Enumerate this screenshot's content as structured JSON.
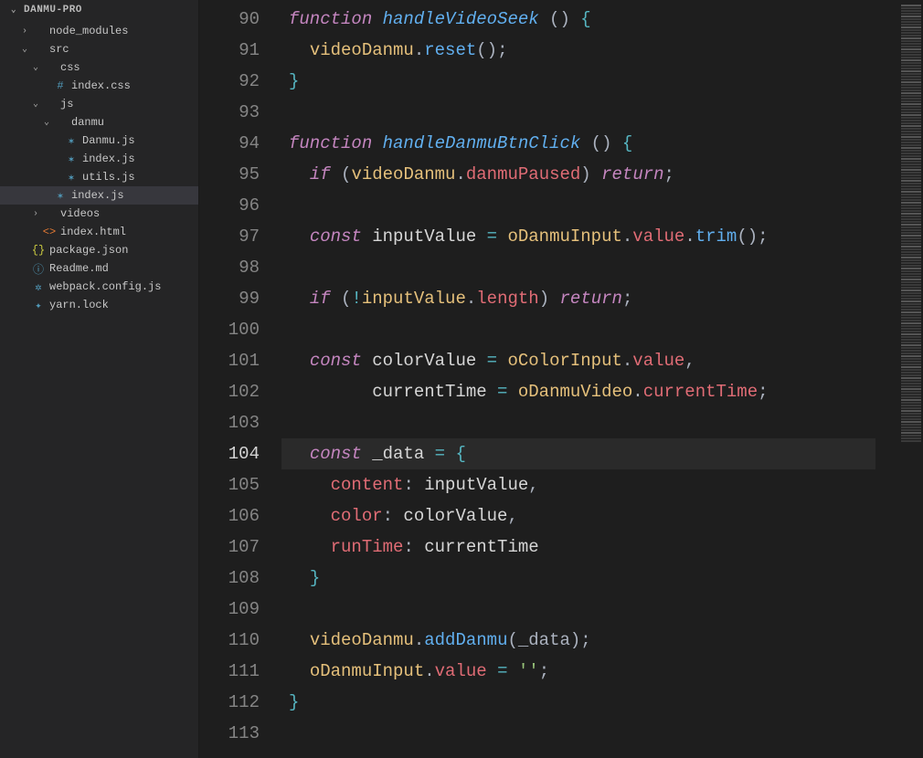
{
  "project": {
    "name": "DANMU-PRO"
  },
  "tree": [
    {
      "depth": 1,
      "twisty": "›",
      "iconClass": "",
      "iconGlyph": "",
      "label": "node_modules",
      "name": "folder-node-modules"
    },
    {
      "depth": 1,
      "twisty": "⌄",
      "iconClass": "",
      "iconGlyph": "",
      "label": "src",
      "name": "folder-src"
    },
    {
      "depth": 2,
      "twisty": "⌄",
      "iconClass": "",
      "iconGlyph": "",
      "label": "css",
      "name": "folder-css"
    },
    {
      "depth": 3,
      "twisty": "",
      "iconClass": "ic-css",
      "iconGlyph": "#",
      "label": "index.css",
      "name": "file-index-css"
    },
    {
      "depth": 2,
      "twisty": "⌄",
      "iconClass": "",
      "iconGlyph": "",
      "label": "js",
      "name": "folder-js"
    },
    {
      "depth": 3,
      "twisty": "⌄",
      "iconClass": "",
      "iconGlyph": "",
      "label": "danmu",
      "name": "folder-danmu"
    },
    {
      "depth": 4,
      "twisty": "",
      "iconClass": "ic-js",
      "iconGlyph": "✶",
      "label": "Danmu.js",
      "name": "file-danmu-js"
    },
    {
      "depth": 4,
      "twisty": "",
      "iconClass": "ic-js",
      "iconGlyph": "✶",
      "label": "index.js",
      "name": "file-danmu-index-js"
    },
    {
      "depth": 4,
      "twisty": "",
      "iconClass": "ic-js",
      "iconGlyph": "✶",
      "label": "utils.js",
      "name": "file-utils-js"
    },
    {
      "depth": 3,
      "twisty": "",
      "iconClass": "ic-js",
      "iconGlyph": "✶",
      "label": "index.js",
      "name": "file-js-index-js",
      "active": true
    },
    {
      "depth": 2,
      "twisty": "›",
      "iconClass": "",
      "iconGlyph": "",
      "label": "videos",
      "name": "folder-videos"
    },
    {
      "depth": 2,
      "twisty": "",
      "iconClass": "ic-html",
      "iconGlyph": "<>",
      "label": "index.html",
      "name": "file-index-html"
    },
    {
      "depth": 1,
      "twisty": "",
      "iconClass": "ic-json",
      "iconGlyph": "{}",
      "label": "package.json",
      "name": "file-package-json"
    },
    {
      "depth": 1,
      "twisty": "",
      "iconClass": "ic-info",
      "iconGlyph": "ⓘ",
      "label": "Readme.md",
      "name": "file-readme-md"
    },
    {
      "depth": 1,
      "twisty": "",
      "iconClass": "ic-gear",
      "iconGlyph": "✲",
      "label": "webpack.config.js",
      "name": "file-webpack-config"
    },
    {
      "depth": 1,
      "twisty": "",
      "iconClass": "ic-lock",
      "iconGlyph": "✦",
      "label": "yarn.lock",
      "name": "file-yarn-lock"
    }
  ],
  "editor": {
    "startLine": 90,
    "currentLine": 104,
    "lines": [
      [
        [
          "kw",
          "function "
        ],
        [
          "fn",
          "handleVideoSeek"
        ],
        [
          "pn",
          " () "
        ],
        [
          "brace",
          "{"
        ]
      ],
      [
        [
          "plain",
          "  "
        ],
        [
          "id",
          "videoDanmu"
        ],
        [
          "pn",
          "."
        ],
        [
          "call",
          "reset"
        ],
        [
          "pn",
          "();"
        ]
      ],
      [
        [
          "brace",
          "}"
        ]
      ],
      [],
      [
        [
          "kw",
          "function "
        ],
        [
          "fn",
          "handleDanmuBtnClick"
        ],
        [
          "pn",
          " () "
        ],
        [
          "brace",
          "{"
        ]
      ],
      [
        [
          "plain",
          "  "
        ],
        [
          "kw",
          "if"
        ],
        [
          "pn",
          " ("
        ],
        [
          "id",
          "videoDanmu"
        ],
        [
          "pn",
          "."
        ],
        [
          "prop",
          "danmuPaused"
        ],
        [
          "pn",
          ") "
        ],
        [
          "kw",
          "return"
        ],
        [
          "pn",
          ";"
        ]
      ],
      [],
      [
        [
          "plain",
          "  "
        ],
        [
          "kw",
          "const"
        ],
        [
          "plain",
          " inputValue "
        ],
        [
          "eq",
          "="
        ],
        [
          "plain",
          " "
        ],
        [
          "id",
          "oDanmuInput"
        ],
        [
          "pn",
          "."
        ],
        [
          "prop",
          "value"
        ],
        [
          "pn",
          "."
        ],
        [
          "call",
          "trim"
        ],
        [
          "pn",
          "();"
        ]
      ],
      [],
      [
        [
          "plain",
          "  "
        ],
        [
          "kw",
          "if"
        ],
        [
          "pn",
          " ("
        ],
        [
          "eq",
          "!"
        ],
        [
          "id",
          "inputValue"
        ],
        [
          "pn",
          "."
        ],
        [
          "prop",
          "length"
        ],
        [
          "pn",
          ") "
        ],
        [
          "kw",
          "return"
        ],
        [
          "pn",
          ";"
        ]
      ],
      [],
      [
        [
          "plain",
          "  "
        ],
        [
          "kw",
          "const"
        ],
        [
          "plain",
          " colorValue "
        ],
        [
          "eq",
          "="
        ],
        [
          "plain",
          " "
        ],
        [
          "id",
          "oColorInput"
        ],
        [
          "pn",
          "."
        ],
        [
          "prop",
          "value"
        ],
        [
          "pn",
          ","
        ]
      ],
      [
        [
          "plain",
          "        currentTime "
        ],
        [
          "eq",
          "="
        ],
        [
          "plain",
          " "
        ],
        [
          "id",
          "oDanmuVideo"
        ],
        [
          "pn",
          "."
        ],
        [
          "prop",
          "currentTime"
        ],
        [
          "pn",
          ";"
        ]
      ],
      [],
      [
        [
          "plain",
          "  "
        ],
        [
          "kw",
          "const"
        ],
        [
          "plain",
          " _data "
        ],
        [
          "eq",
          "="
        ],
        [
          "plain",
          " "
        ],
        [
          "brace",
          "{"
        ]
      ],
      [
        [
          "plain",
          "    "
        ],
        [
          "prop",
          "content"
        ],
        [
          "pn",
          ":"
        ],
        [
          "plain",
          " inputValue"
        ],
        [
          "pn",
          ","
        ]
      ],
      [
        [
          "plain",
          "    "
        ],
        [
          "prop",
          "color"
        ],
        [
          "pn",
          ":"
        ],
        [
          "plain",
          " colorValue"
        ],
        [
          "pn",
          ","
        ]
      ],
      [
        [
          "plain",
          "    "
        ],
        [
          "prop",
          "runTime"
        ],
        [
          "pn",
          ":"
        ],
        [
          "plain",
          " currentTime"
        ]
      ],
      [
        [
          "plain",
          "  "
        ],
        [
          "brace",
          "}"
        ]
      ],
      [],
      [
        [
          "plain",
          "  "
        ],
        [
          "id",
          "videoDanmu"
        ],
        [
          "pn",
          "."
        ],
        [
          "call",
          "addDanmu"
        ],
        [
          "pn",
          "(_data);"
        ]
      ],
      [
        [
          "plain",
          "  "
        ],
        [
          "id",
          "oDanmuInput"
        ],
        [
          "pn",
          "."
        ],
        [
          "prop",
          "value"
        ],
        [
          "plain",
          " "
        ],
        [
          "eq",
          "="
        ],
        [
          "plain",
          " "
        ],
        [
          "str",
          "''"
        ],
        [
          "pn",
          ";"
        ]
      ],
      [
        [
          "brace",
          "}"
        ]
      ],
      []
    ]
  }
}
